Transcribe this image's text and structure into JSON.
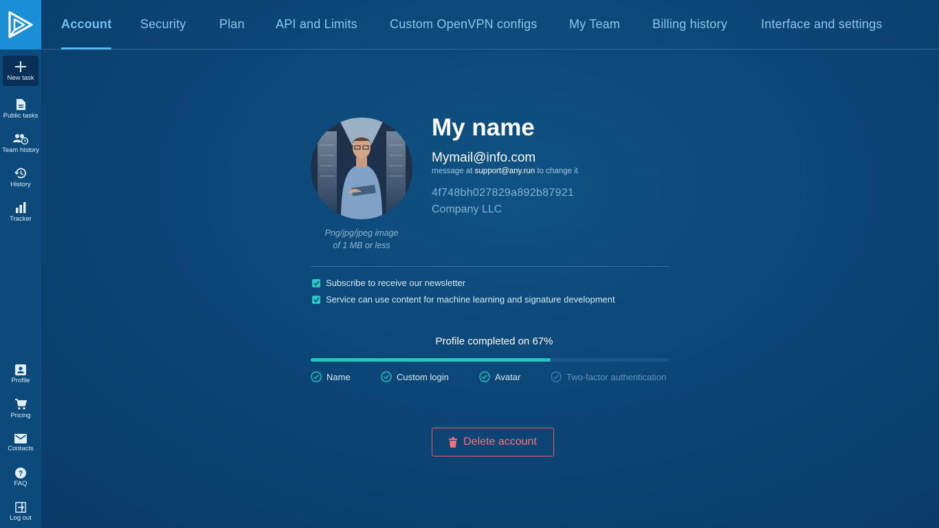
{
  "sidebar": {
    "top_items": [
      {
        "label": "New task",
        "icon": "plus-icon"
      },
      {
        "label": "Public tasks",
        "icon": "document-icon"
      },
      {
        "label": "Team history",
        "icon": "team-history-icon"
      },
      {
        "label": "History",
        "icon": "history-icon"
      },
      {
        "label": "Tracker",
        "icon": "bar-chart-icon"
      }
    ],
    "bottom_items": [
      {
        "label": "Profile",
        "icon": "profile-icon"
      },
      {
        "label": "Pricing",
        "icon": "cart-icon"
      },
      {
        "label": "Contacts",
        "icon": "mail-icon"
      },
      {
        "label": "FAQ",
        "icon": "help-icon"
      },
      {
        "label": "Log out",
        "icon": "logout-icon"
      }
    ]
  },
  "tabs": [
    {
      "label": "Account",
      "active": true
    },
    {
      "label": "Security"
    },
    {
      "label": "Plan"
    },
    {
      "label": "API and Limits"
    },
    {
      "label": "Custom OpenVPN configs"
    },
    {
      "label": "My Team"
    },
    {
      "label": "Billing history"
    },
    {
      "label": "Interface and settings"
    }
  ],
  "profile": {
    "avatar_hint_line1": "Png/jpg/jpeg image",
    "avatar_hint_line2": "of 1 MB or less",
    "name": "My name",
    "email": "Mymail@info.com",
    "email_note_prefix": "message at ",
    "email_note_link": "support@any.run",
    "email_note_suffix": " to change it",
    "user_id": "4f748bh027829a892b87921",
    "company": "Company LLC"
  },
  "options": [
    {
      "label": "Subscribe to receive our newsletter",
      "checked": true
    },
    {
      "label": "Service can use content for machine learning and signature development",
      "checked": true
    }
  ],
  "completion": {
    "title": "Profile completed on 67%",
    "percent": 67,
    "steps": [
      {
        "label": "Name",
        "done": true
      },
      {
        "label": "Custom login",
        "done": true
      },
      {
        "label": "Avatar",
        "done": true
      },
      {
        "label": "Two-factor authentication",
        "done": false
      }
    ]
  },
  "delete_button": {
    "label": "Delete account"
  },
  "colors": {
    "accent": "#58b7ee",
    "progress": "#22c9c0",
    "danger": "#ff6f78",
    "logo_bg": "#1b8fd6"
  }
}
